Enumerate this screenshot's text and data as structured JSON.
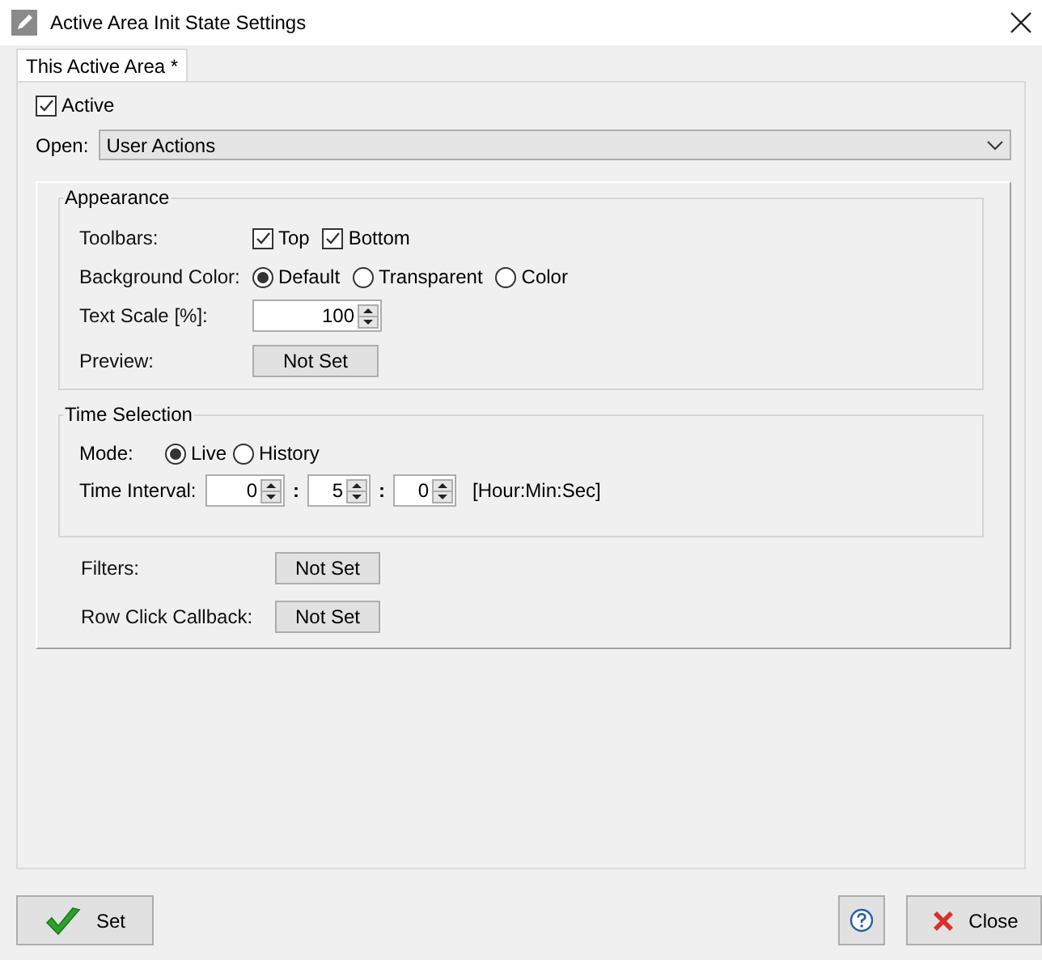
{
  "window": {
    "title": "Active Area Init State Settings"
  },
  "tabs": [
    {
      "label": "This Active Area *",
      "selected": true
    }
  ],
  "active": {
    "label": "Active",
    "checked": true
  },
  "open": {
    "label": "Open:",
    "value": "User Actions"
  },
  "appearance": {
    "title": "Appearance",
    "toolbars": {
      "label": "Toolbars:",
      "options": [
        {
          "label": "Top",
          "checked": true
        },
        {
          "label": "Bottom",
          "checked": true
        }
      ]
    },
    "background_color": {
      "label": "Background Color:",
      "options": [
        {
          "label": "Default",
          "selected": true
        },
        {
          "label": "Transparent",
          "selected": false
        },
        {
          "label": "Color",
          "selected": false
        }
      ]
    },
    "text_scale": {
      "label": "Text Scale [%]:",
      "value": "100"
    },
    "preview": {
      "label": "Preview:",
      "button": "Not Set"
    }
  },
  "time_selection": {
    "title": "Time Selection",
    "mode": {
      "label": "Mode:",
      "options": [
        {
          "label": "Live",
          "selected": true
        },
        {
          "label": "History",
          "selected": false
        }
      ]
    },
    "time_interval": {
      "label": "Time Interval:",
      "fields": [
        "0",
        "5",
        "0"
      ],
      "separators": [
        ":",
        ":"
      ],
      "unit": "[Hour:Min:Sec]"
    }
  },
  "filters": {
    "label": "Filters:",
    "button": "Not Set"
  },
  "row_click_callback": {
    "label": "Row Click Callback:",
    "button": "Not Set"
  },
  "buttons": [
    {
      "kind": "set",
      "label": "Set"
    },
    {
      "kind": "help"
    },
    {
      "kind": "close",
      "label": "Close"
    }
  ]
}
